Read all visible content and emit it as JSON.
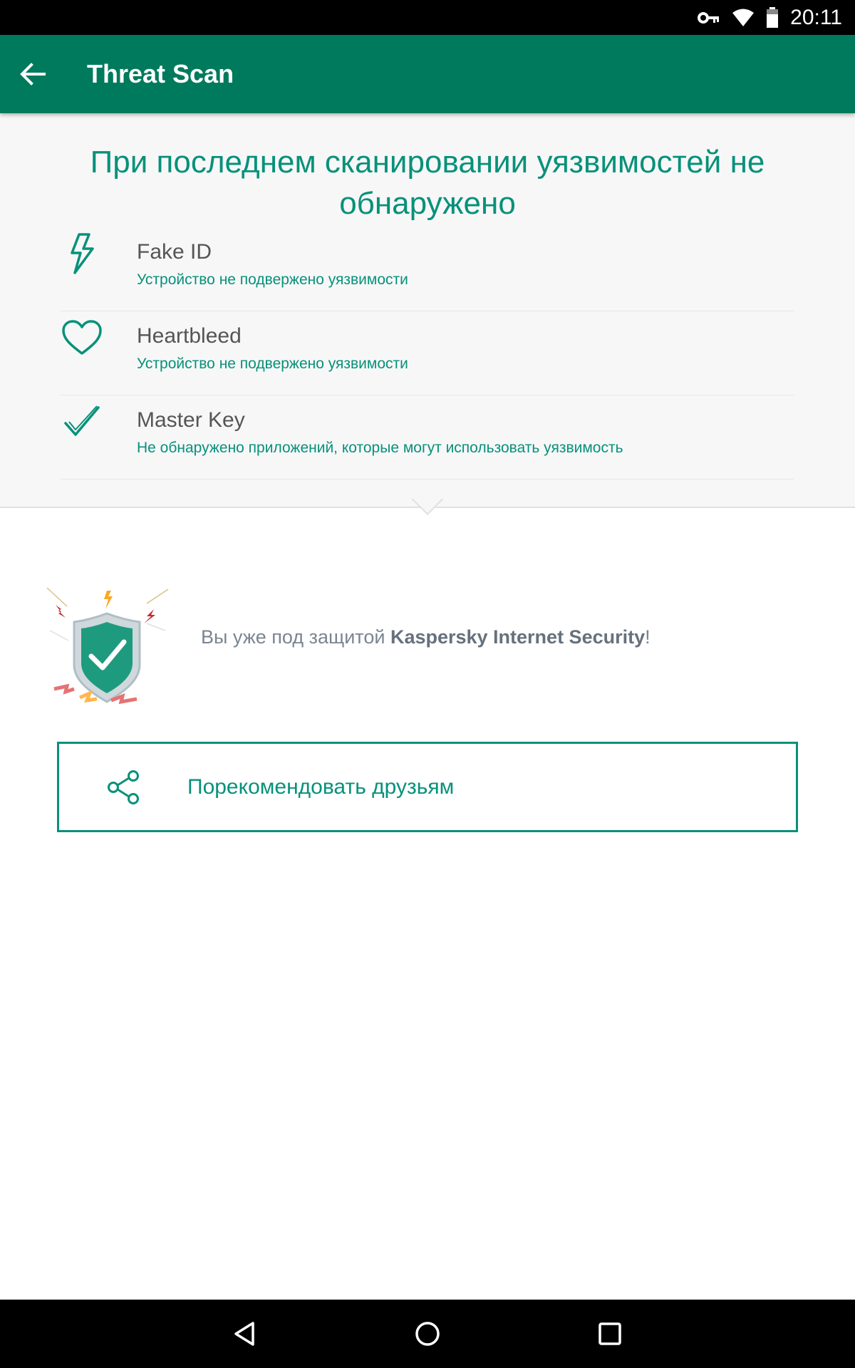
{
  "status_bar": {
    "time": "20:11"
  },
  "app_bar": {
    "title": "Threat Scan"
  },
  "results": {
    "title": "При последнем сканировании уязвимостей не обнаружено",
    "items": [
      {
        "name": "Fake ID",
        "status": "Устройство не подвержено уязвимости",
        "icon": "lightning-icon"
      },
      {
        "name": "Heartbleed",
        "status": "Устройство не подвержено уязвимости",
        "icon": "heart-icon"
      },
      {
        "name": "Master Key",
        "status": "Не обнаружено приложений, которые могут использовать уязвимость",
        "icon": "checkmark-icon"
      }
    ]
  },
  "protection": {
    "prefix": "Вы уже под защитой ",
    "brand": "Kaspersky Internet Security",
    "suffix": "!"
  },
  "recommend": {
    "label": "Порекомендовать друзьям"
  },
  "colors": {
    "app_bar": "#007a5c",
    "accent": "#07917a",
    "panel_bg": "#f7f7f7"
  }
}
